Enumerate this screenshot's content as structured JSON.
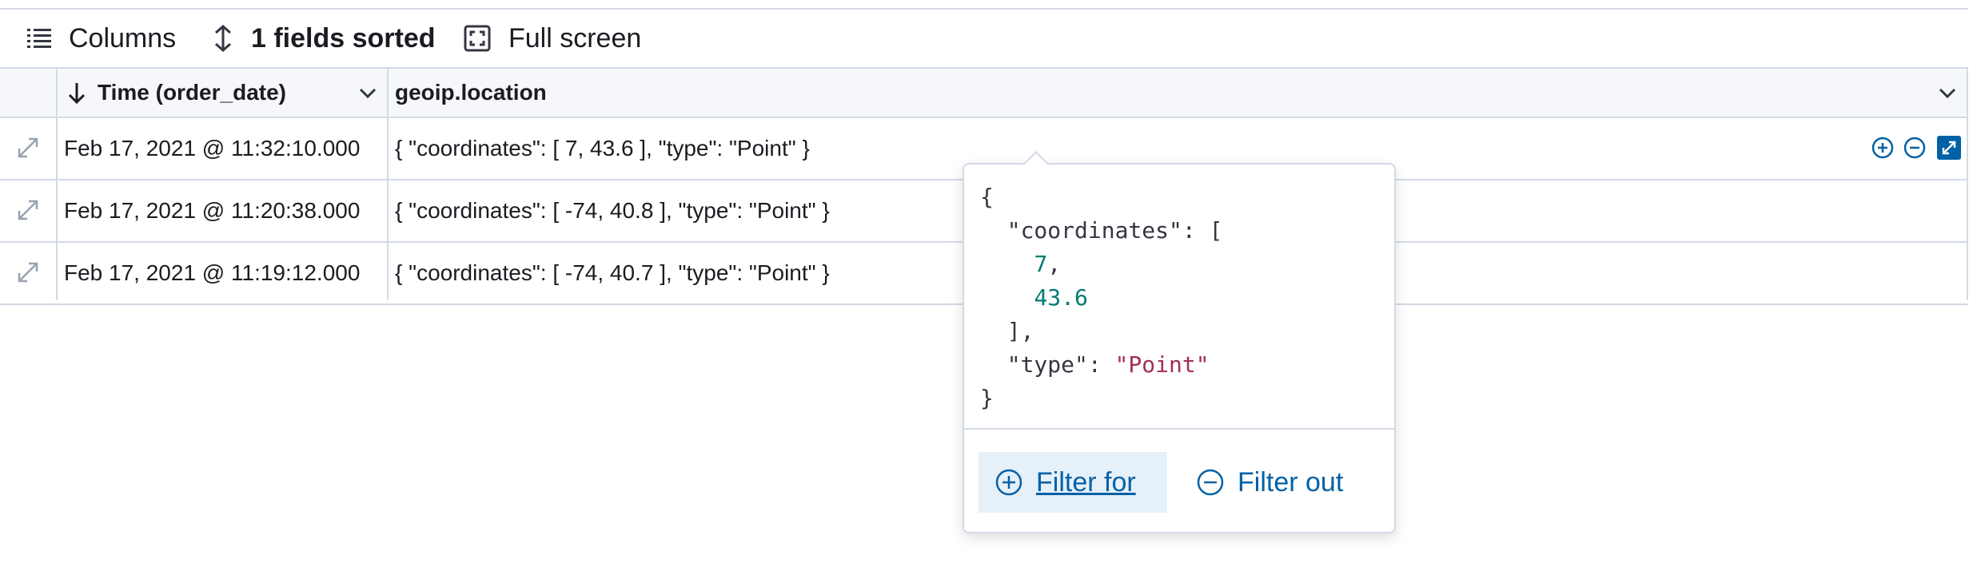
{
  "toolbar": {
    "columns_label": "Columns",
    "sorted_label": "1 fields sorted",
    "fullscreen_label": "Full screen"
  },
  "table": {
    "columns": [
      {
        "label": "Time (order_date)",
        "sort": "descending"
      },
      {
        "label": "geoip.location"
      }
    ],
    "rows": [
      {
        "time": "Feb 17, 2021 @ 11:32:10.000",
        "location": "{ \"coordinates\": [ 7, 43.6 ], \"type\": \"Point\" }"
      },
      {
        "time": "Feb 17, 2021 @ 11:20:38.000",
        "location": "{ \"coordinates\": [ -74, 40.8 ], \"type\": \"Point\" }"
      },
      {
        "time": "Feb 17, 2021 @ 11:19:12.000",
        "location": "{ \"coordinates\": [ -74, 40.7 ], \"type\": \"Point\" }"
      }
    ]
  },
  "popover": {
    "json_lines": {
      "open": "{",
      "coord_key": "  \"coordinates\": [",
      "val1": "7",
      "val2": "43.6",
      "arr_close": "  ],",
      "type_key": "  \"type\": ",
      "type_val": "\"Point\"",
      "close": "}"
    },
    "filter_for_label": "Filter for",
    "filter_out_label": "Filter out"
  },
  "colors": {
    "accent": "#0061a6",
    "border": "#d3dae6",
    "number": "#017d73",
    "string": "#a12f56"
  }
}
